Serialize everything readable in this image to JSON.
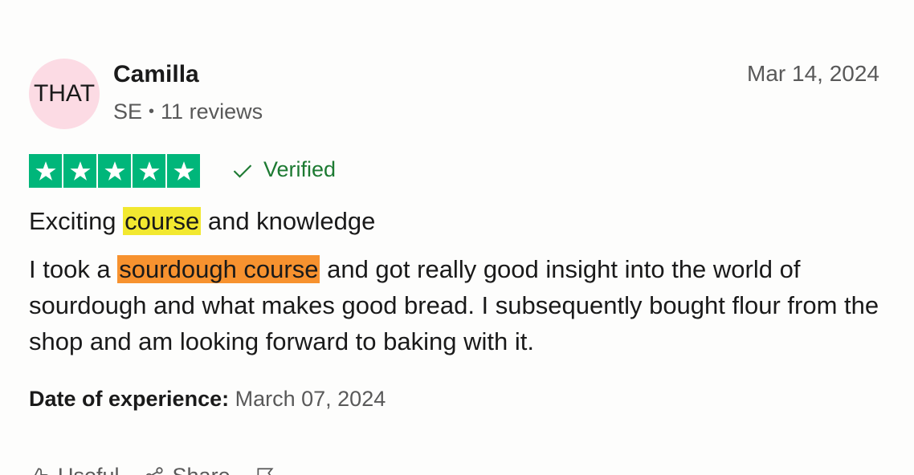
{
  "reviewer": {
    "avatar_initials": "THAT",
    "name": "Camilla",
    "country": "SE",
    "reviews_count": "11 reviews"
  },
  "review": {
    "date": "Mar 14, 2024",
    "rating": 5,
    "rating_max": 5,
    "verified_label": "Verified",
    "title_before": "Exciting ",
    "title_highlight": "course",
    "title_after": " and knowledge",
    "body_before": "I took a ",
    "body_highlight": "sourdough course",
    "body_after": " and got really good insight into the world of sourdough and what makes good bread. I subsequently bought flour from the shop and am looking forward to baking with it.",
    "experience_label": "Date of experience:",
    "experience_date": "March 07, 2024"
  },
  "actions": {
    "useful_label": "Useful",
    "share_label": "Share"
  },
  "colors": {
    "star_green": "#00b67a",
    "verified_green": "#1d7a32",
    "avatar_bg": "#fcdbe4",
    "highlight_yellow": "#f2e830",
    "highlight_orange": "#f7922f"
  },
  "icons": [
    "star-icon",
    "checkmark-icon",
    "thumbs-up-icon",
    "share-icon",
    "flag-icon"
  ]
}
